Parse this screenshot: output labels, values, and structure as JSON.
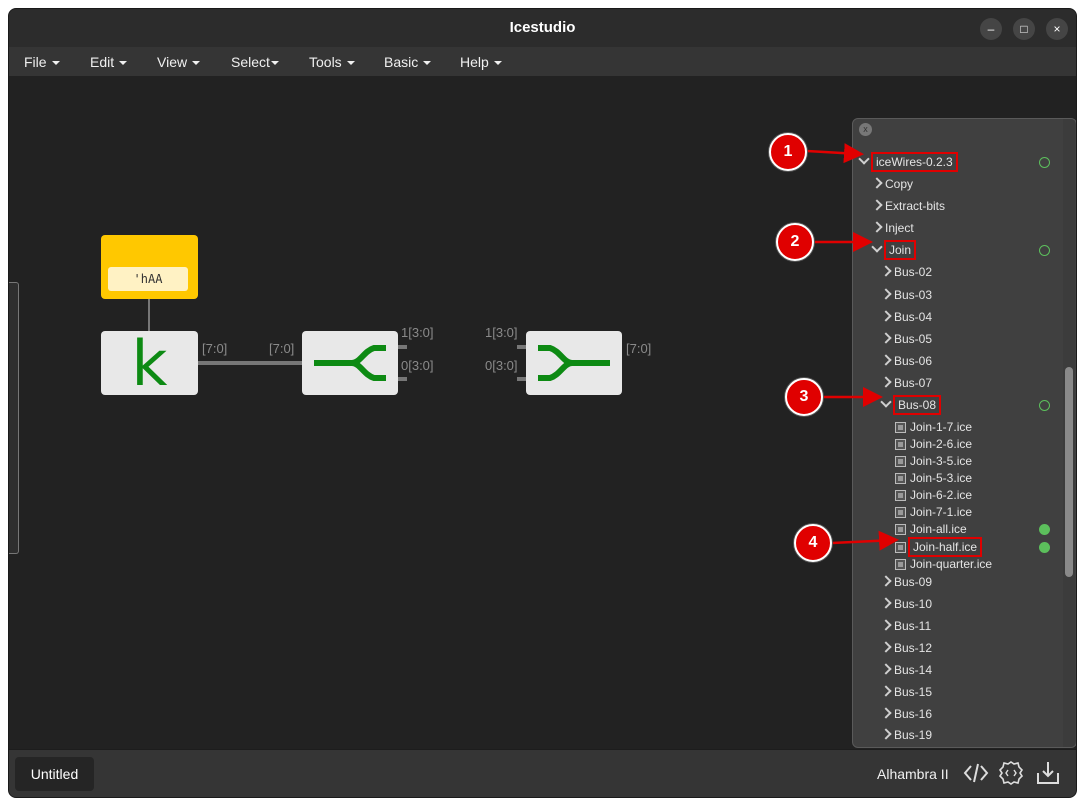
{
  "window": {
    "title": "Icestudio"
  },
  "window_controls": {
    "minimize": "–",
    "maximize": "□",
    "close": "×"
  },
  "menu": [
    "File",
    "Edit",
    "View",
    "Select",
    "Tools",
    "Basic",
    "Help"
  ],
  "canvas": {
    "constant_value": "'hAA",
    "constant_block_letter": "k",
    "wire_labels": {
      "k_out": "[7:0]",
      "split_in": "[7:0]",
      "split_out1": "1[3:0]",
      "split_out0": "0[3:0]",
      "join_in1": "1[3:0]",
      "join_in0": "0[3:0]",
      "join_out": "[7:0]"
    }
  },
  "panel": {
    "close_label": "x",
    "rows": [
      {
        "label": "iceWires-0.2.3",
        "kind": "folder-open",
        "level": 0,
        "highlight": true,
        "marker": "open"
      },
      {
        "label": "Copy",
        "kind": "folder",
        "level": 1
      },
      {
        "label": "Extract-bits",
        "kind": "folder",
        "level": 1
      },
      {
        "label": "Inject",
        "kind": "folder",
        "level": 1
      },
      {
        "label": "Join",
        "kind": "folder-open",
        "level": 1,
        "highlight": true,
        "marker": "open"
      },
      {
        "label": "Bus-02",
        "kind": "folder",
        "level": 2
      },
      {
        "label": "Bus-03",
        "kind": "folder",
        "level": 2
      },
      {
        "label": "Bus-04",
        "kind": "folder",
        "level": 2
      },
      {
        "label": "Bus-05",
        "kind": "folder",
        "level": 2
      },
      {
        "label": "Bus-06",
        "kind": "folder",
        "level": 2
      },
      {
        "label": "Bus-07",
        "kind": "folder",
        "level": 2
      },
      {
        "label": "Bus-08",
        "kind": "folder-open",
        "level": 2,
        "highlight": true,
        "marker": "open"
      },
      {
        "label": "Join-1-7.ice",
        "kind": "file",
        "level": 3
      },
      {
        "label": "Join-2-6.ice",
        "kind": "file",
        "level": 3
      },
      {
        "label": "Join-3-5.ice",
        "kind": "file",
        "level": 3
      },
      {
        "label": "Join-5-3.ice",
        "kind": "file",
        "level": 3
      },
      {
        "label": "Join-6-2.ice",
        "kind": "file",
        "level": 3
      },
      {
        "label": "Join-7-1.ice",
        "kind": "file",
        "level": 3
      },
      {
        "label": "Join-all.ice",
        "kind": "file",
        "level": 3,
        "marker": "filled"
      },
      {
        "label": "Join-half.ice",
        "kind": "file",
        "level": 3,
        "highlight": true,
        "marker": "filled"
      },
      {
        "label": "Join-quarter.ice",
        "kind": "file",
        "level": 3
      },
      {
        "label": "Bus-09",
        "kind": "folder",
        "level": 2
      },
      {
        "label": "Bus-10",
        "kind": "folder",
        "level": 2
      },
      {
        "label": "Bus-11",
        "kind": "folder",
        "level": 2
      },
      {
        "label": "Bus-12",
        "kind": "folder",
        "level": 2
      },
      {
        "label": "Bus-14",
        "kind": "folder",
        "level": 2
      },
      {
        "label": "Bus-15",
        "kind": "folder",
        "level": 2
      },
      {
        "label": "Bus-16",
        "kind": "folder",
        "level": 2
      },
      {
        "label": "Bus-19",
        "kind": "folder",
        "level": 2
      }
    ]
  },
  "callouts": [
    "1",
    "2",
    "3",
    "4"
  ],
  "statusbar": {
    "tab": "Untitled",
    "board": "Alhambra II"
  },
  "icons": {
    "code": "code-icon",
    "gear": "gear-code-icon",
    "download": "download-icon"
  },
  "colors": {
    "accent_green": "#0d8a13",
    "callout_red": "#e00000",
    "constant_yellow": "#ffc800"
  }
}
